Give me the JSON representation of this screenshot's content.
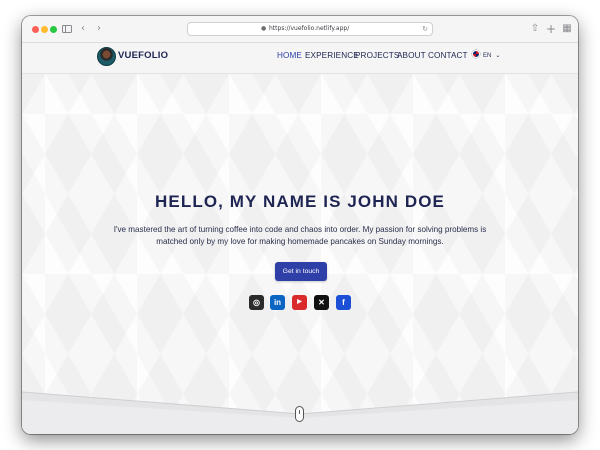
{
  "browser": {
    "url": "https://vuefolio.netlify.app/",
    "icons": {
      "back": "chevron-left-icon",
      "forward": "chevron-right-icon",
      "lock": "lock-icon",
      "reload": "reload-icon",
      "share": "share-icon",
      "new_tab": "plus-icon",
      "tabs": "tab-overview-icon"
    }
  },
  "header": {
    "brand": "VUEFOLIO",
    "nav": [
      "HOME",
      "EXPERIENCE",
      "PROJECTS",
      "ABOUT",
      "CONTACT"
    ],
    "active_nav": "HOME",
    "language": "EN"
  },
  "hero": {
    "title": "HELLO, MY NAME IS JOHN DOE",
    "description": "I've mastered the art of turning coffee into code and chaos into order. My passion for solving problems is matched only by my love for making homemade pancakes on Sunday mornings.",
    "cta_label": "Get in touch",
    "socials": [
      {
        "name": "github-icon",
        "glyph": "◎",
        "color": "#2b2b2b"
      },
      {
        "name": "linkedin-icon",
        "glyph": "in",
        "color": "#0a66c2"
      },
      {
        "name": "youtube-icon",
        "glyph": "▶",
        "color": "#d92b2b"
      },
      {
        "name": "x-icon",
        "glyph": "✕",
        "color": "#111111"
      },
      {
        "name": "facebook-icon",
        "glyph": "f",
        "color": "#1a4fd6"
      }
    ]
  },
  "colors": {
    "accent": "#2f3fa8",
    "text_dark": "#1f2552"
  }
}
